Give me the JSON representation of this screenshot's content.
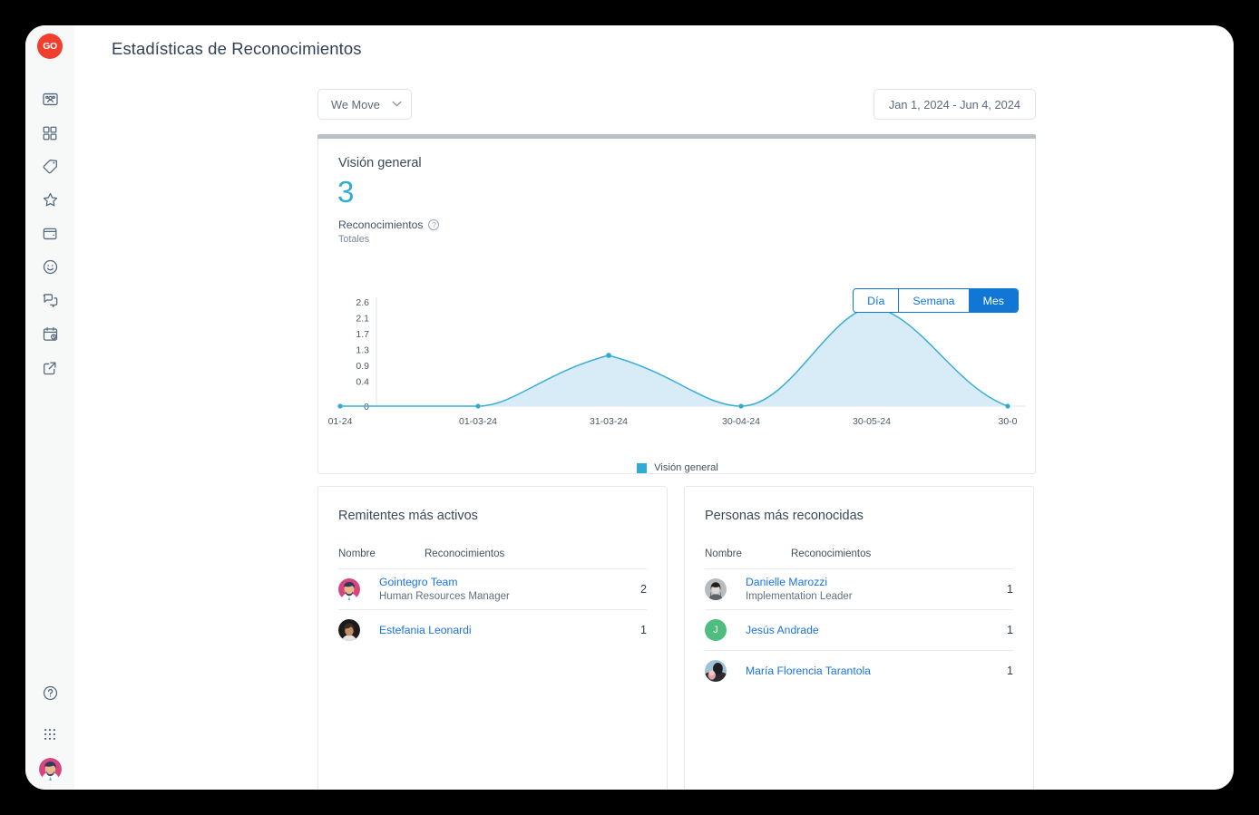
{
  "app": {
    "logo_text": "GO",
    "logo_color": "#f23e2e",
    "page_title": "Estadísticas de Reconocimientos"
  },
  "sidebar": {
    "items": [
      {
        "icon": "people-card-icon",
        "name": "sidebar-item-people"
      },
      {
        "icon": "grid-icon",
        "name": "sidebar-item-dashboard"
      },
      {
        "icon": "tag-icon",
        "name": "sidebar-item-tags"
      },
      {
        "icon": "star-icon",
        "name": "sidebar-item-recognitions"
      },
      {
        "icon": "wallet-icon",
        "name": "sidebar-item-wallet"
      },
      {
        "icon": "smiley-icon",
        "name": "sidebar-item-mood"
      },
      {
        "icon": "chat-bubbles-icon",
        "name": "sidebar-item-messages"
      },
      {
        "icon": "calendar-clock-icon",
        "name": "sidebar-item-calendar"
      },
      {
        "icon": "external-link-icon",
        "name": "sidebar-item-external"
      }
    ],
    "bottom": [
      {
        "icon": "help-circle-icon",
        "name": "sidebar-help"
      },
      {
        "icon": "apps-grid-icon",
        "name": "sidebar-apps"
      },
      {
        "icon": "avatar-icon",
        "name": "sidebar-user-avatar"
      }
    ]
  },
  "controls": {
    "company_select": {
      "value": "We Move",
      "chevron": "chevron-down-icon"
    },
    "date_range": "Jan 1, 2024 - Jun 4, 2024"
  },
  "overview": {
    "title": "Visión general",
    "big_number": "3",
    "metric_label": "Reconocimientos",
    "metric_help": "?",
    "metric_sub": "Totales",
    "accent_color": "#2fabd4",
    "toggle": {
      "options": [
        {
          "label": "Día",
          "active": false
        },
        {
          "label": "Semana",
          "active": false
        },
        {
          "label": "Mes",
          "active": true
        }
      ],
      "active_color": "#1176d4"
    },
    "legend": [
      {
        "label": "Visión general",
        "color": "#2fabd4"
      }
    ]
  },
  "chart_data": {
    "type": "area",
    "title": "Visión general",
    "xlabel": "",
    "ylabel": "",
    "x": [
      "01-24",
      "01-03-24",
      "31-03-24",
      "30-04-24",
      "30-05-24",
      "30-0"
    ],
    "categories": [
      "01-24",
      "01-03-24",
      "31-03-24",
      "30-04-24",
      "30-05-24",
      "30-0"
    ],
    "values": [
      0,
      0,
      1,
      0,
      2,
      0
    ],
    "series": [
      {
        "name": "Visión general",
        "values": [
          0,
          0,
          1,
          0,
          2,
          0
        ],
        "color": "#2fabd4",
        "fill": "#d9ecf5"
      }
    ],
    "ylim": [
      0,
      2.6
    ],
    "yticks": [
      "0",
      "0.4",
      "0.9",
      "1.3",
      "1.7",
      "2.1",
      "2.6"
    ],
    "ytick_values": [
      0,
      0.4,
      0.9,
      1.3,
      1.7,
      2.1,
      2.6
    ],
    "grid": false,
    "legend_position": "bottom",
    "interpolation": "smooth"
  },
  "senders": {
    "title": "Remitentes más activos",
    "columns": [
      "Nombre",
      "Reconocimientos"
    ],
    "rows": [
      {
        "name": "Gointegro Team",
        "role": "Human Resources Manager",
        "count": "2",
        "avatar_type": "photo-pink"
      },
      {
        "name": "Estefania Leonardi",
        "role": "",
        "count": "1",
        "avatar_type": "photo-dark"
      }
    ]
  },
  "recipients": {
    "title": "Personas más reconocidas",
    "columns": [
      "Nombre",
      "Reconocimientos"
    ],
    "rows": [
      {
        "name": "Danielle Marozzi",
        "role": "Implementation Leader",
        "count": "1",
        "avatar_type": "photo-gray"
      },
      {
        "name": "Jesús Andrade",
        "role": "",
        "count": "1",
        "avatar_type": "initial-green",
        "initial": "J"
      },
      {
        "name": "María Florencia Tarantola",
        "role": "",
        "count": "1",
        "avatar_type": "photo-blue"
      }
    ]
  }
}
